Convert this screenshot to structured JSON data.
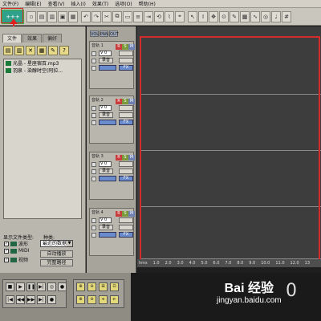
{
  "menubar": {
    "items": [
      "文件(F)",
      "编辑(E)",
      "查看(V)",
      "插入(I)",
      "效果(T)",
      "选项(O)",
      "帮助(H)"
    ]
  },
  "toolbar": {
    "mode_label": "+++"
  },
  "left_panel": {
    "tabs": [
      "文件",
      "效果",
      "偏好"
    ],
    "files": [
      "光晶 - 星座宿百.mp3",
      "羽泉 - 染醇时空(阿拉..."
    ],
    "show_type_label": "显示文件类型:",
    "kind_label": "种类:",
    "types": [
      "波形",
      "MIDI",
      "视频"
    ],
    "kind_select": "最近的数据",
    "auto_play": "自动播放",
    "full_path": "完整路径"
  },
  "track_panel": {
    "view_tabs": [
      "VOL",
      "PAN",
      "OUT"
    ],
    "tracks": [
      {
        "name": "音轨 1",
        "vol": "V 0",
        "left_btn": "录音",
        "right_btn": "FX"
      },
      {
        "name": "音轨 2",
        "vol": "V 0",
        "left_btn": "录音",
        "right_btn": "FX"
      },
      {
        "name": "音轨 3",
        "vol": "V 0",
        "left_btn": "录音",
        "right_btn": "FX"
      },
      {
        "name": "音轨 4",
        "vol": "V 0",
        "left_btn": "录音",
        "right_btn": "FX"
      }
    ],
    "rsm": [
      "R",
      "S",
      "M"
    ]
  },
  "ruler": {
    "labels": [
      "hms",
      "1.0",
      "2.0",
      "3.0",
      "4.0",
      "5.0",
      "6.0",
      "7.0",
      "8.0",
      "9.0",
      "10.0",
      "11.0",
      "12.0",
      "13"
    ]
  },
  "time_display": "0",
  "watermark": {
    "brand": "Bai 经验",
    "url": "jingyan.baidu.com"
  }
}
